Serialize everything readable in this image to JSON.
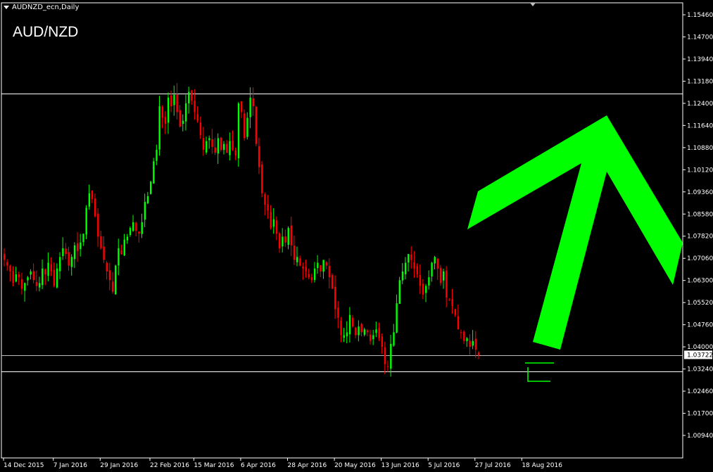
{
  "header": {
    "symbol_title": "AUDNZD_ecn,Daily",
    "pair_label": "AUD/NZD"
  },
  "colors": {
    "background": "#000000",
    "bull": "#00ff00",
    "bear": "#ff0000",
    "arrow": "#00ff00",
    "lines": "#ffffff",
    "axis_text": "#ffffff"
  },
  "chart_data": {
    "type": "candlestick",
    "title": "AUD/NZD",
    "ylim": [
      1.0894,
      1.1546
    ],
    "grid": false,
    "y_ticks": [
      "1.15460",
      "1.14700",
      "1.13940",
      "1.13180",
      "1.12400",
      "1.11640",
      "1.10880",
      "1.10120",
      "1.09360",
      "1.08580",
      "1.07820",
      "1.07060",
      "1.06300",
      "1.05520",
      "1.04760",
      "1.04000",
      "1.03240",
      "1.02460",
      "1.01700",
      "1.00940"
    ],
    "current_price_label": "1.03722",
    "x_ticks": [
      {
        "label": "14 Dec 2015",
        "index": 0
      },
      {
        "label": "7 Jan 2016",
        "index": 17
      },
      {
        "label": "29 Jan 2016",
        "index": 33
      },
      {
        "label": "22 Feb 2016",
        "index": 50
      },
      {
        "label": "15 Mar 2016",
        "index": 65
      },
      {
        "label": "6 Apr 2016",
        "index": 81
      },
      {
        "label": "28 Apr 2016",
        "index": 97
      },
      {
        "label": "20 May 2016",
        "index": 113
      },
      {
        "label": "13 Jun 2016",
        "index": 129
      },
      {
        "label": "5 Jul 2016",
        "index": 145
      },
      {
        "label": "27 Jul 2016",
        "index": 161
      },
      {
        "label": "18 Aug 2016",
        "index": 177
      }
    ],
    "horizontal_levels": [
      1.1274,
      1.037,
      1.0316
    ],
    "close_series": [
      1.07,
      1.068,
      1.066,
      1.062,
      1.065,
      1.064,
      1.06,
      1.062,
      1.064,
      1.066,
      1.063,
      1.061,
      1.062,
      1.067,
      1.065,
      1.069,
      1.066,
      1.061,
      1.067,
      1.071,
      1.074,
      1.072,
      1.068,
      1.071,
      1.075,
      1.073,
      1.076,
      1.079,
      1.088,
      1.093,
      1.091,
      1.085,
      1.078,
      1.074,
      1.07,
      1.066,
      1.063,
      1.059,
      1.068,
      1.074,
      1.072,
      1.077,
      1.078,
      1.081,
      1.083,
      1.08,
      1.079,
      1.083,
      1.09,
      1.092,
      1.097,
      1.104,
      1.108,
      1.123,
      1.119,
      1.117,
      1.126,
      1.123,
      1.127,
      1.121,
      1.116,
      1.118,
      1.124,
      1.128,
      1.125,
      1.121,
      1.118,
      1.113,
      1.108,
      1.111,
      1.112,
      1.109,
      1.107,
      1.112,
      1.108,
      1.11,
      1.107,
      1.111,
      1.108,
      1.106,
      1.124,
      1.121,
      1.112,
      1.119,
      1.126,
      1.123,
      1.11,
      1.102,
      1.093,
      1.089,
      1.087,
      1.081,
      1.084,
      1.079,
      1.074,
      1.078,
      1.076,
      1.081,
      1.075,
      1.07,
      1.071,
      1.068,
      1.067,
      1.066,
      1.064,
      1.063,
      1.067,
      1.069,
      1.066,
      1.07,
      1.068,
      1.064,
      1.06,
      1.053,
      1.05,
      1.044,
      1.044,
      1.045,
      1.051,
      1.047,
      1.044,
      1.047,
      1.045,
      1.046,
      1.045,
      1.042,
      1.044,
      1.046,
      1.043,
      1.04,
      1.034,
      1.033,
      1.041,
      1.045,
      1.055,
      1.063,
      1.066,
      1.069,
      1.072,
      1.07,
      1.067,
      1.065,
      1.061,
      1.058,
      1.061,
      1.064,
      1.069,
      1.071,
      1.067,
      1.062,
      1.066,
      1.057,
      1.056,
      1.054,
      1.051,
      1.046,
      1.045,
      1.042,
      1.043,
      1.04,
      1.042,
      1.039,
      1.037
    ]
  }
}
